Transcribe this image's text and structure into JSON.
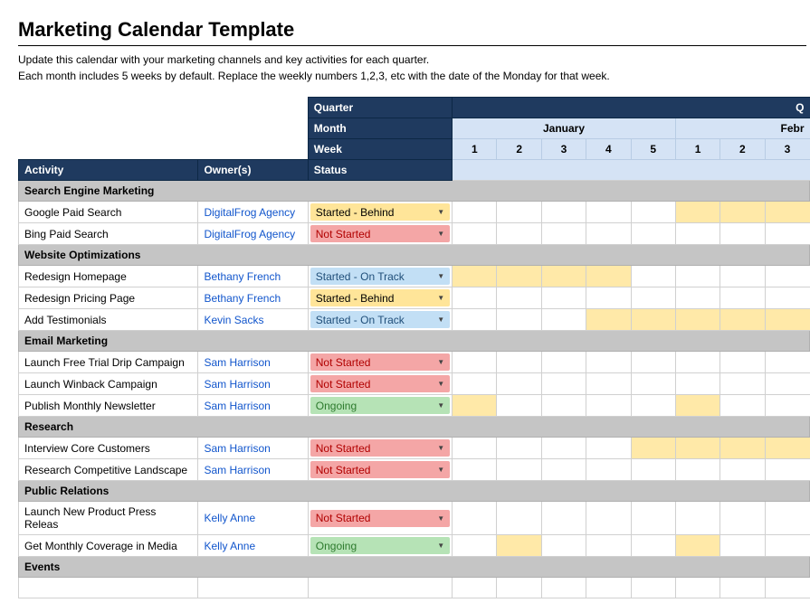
{
  "page": {
    "title": "Marketing Calendar Template",
    "subtitle_line1": "Update this calendar with your marketing channels and key activities for each quarter.",
    "subtitle_line2": "Each month includes 5 weeks by default. Replace the weekly numbers 1,2,3, etc with the date of the Monday for that week."
  },
  "headers": {
    "quarter": "Quarter",
    "q1_partial": "Q",
    "month": "Month",
    "week": "Week",
    "january": "January",
    "february_partial": "Febr",
    "activity": "Activity",
    "owner": "Owner(s)",
    "status": "Status",
    "w1": "1",
    "w2": "2",
    "w3": "3",
    "w4": "4",
    "w5": "5",
    "f1": "1",
    "f2": "2",
    "f3": "3"
  },
  "sections": [
    {
      "name": "Search Engine Marketing",
      "rows": [
        {
          "activity": "Google Paid Search",
          "owner": "DigitalFrog Agency",
          "status": "Started - Behind",
          "status_class": "status-behind",
          "highlights": [
            5,
            6,
            7
          ]
        },
        {
          "activity": "Bing Paid Search",
          "owner": "DigitalFrog Agency",
          "status": "Not Started",
          "status_class": "status-not-started",
          "highlights": []
        }
      ]
    },
    {
      "name": "Website Optimizations",
      "rows": [
        {
          "activity": "Redesign Homepage",
          "owner": "Bethany French",
          "status": "Started - On Track",
          "status_class": "status-on-track",
          "highlights": [
            0,
            1,
            2,
            3
          ]
        },
        {
          "activity": "Redesign Pricing Page",
          "owner": "Bethany French",
          "status": "Started - Behind",
          "status_class": "status-behind",
          "highlights": []
        },
        {
          "activity": "Add Testimonials",
          "owner": "Kevin Sacks",
          "status": "Started - On Track",
          "status_class": "status-on-track",
          "highlights": [
            3,
            4,
            5,
            6,
            7
          ]
        }
      ]
    },
    {
      "name": "Email Marketing",
      "rows": [
        {
          "activity": "Launch Free Trial Drip Campaign",
          "owner": "Sam Harrison",
          "status": "Not Started",
          "status_class": "status-not-started",
          "highlights": []
        },
        {
          "activity": "Launch Winback Campaign",
          "owner": "Sam Harrison",
          "status": "Not Started",
          "status_class": "status-not-started",
          "highlights": []
        },
        {
          "activity": "Publish Monthly Newsletter",
          "owner": "Sam Harrison",
          "status": "Ongoing",
          "status_class": "status-ongoing",
          "highlights": [
            0,
            5
          ]
        }
      ]
    },
    {
      "name": "Research",
      "rows": [
        {
          "activity": "Interview Core Customers",
          "owner": "Sam Harrison",
          "status": "Not Started",
          "status_class": "status-not-started",
          "highlights": [
            4,
            5,
            6,
            7
          ]
        },
        {
          "activity": "Research Competitive Landscape",
          "owner": "Sam Harrison",
          "status": "Not Started",
          "status_class": "status-not-started",
          "highlights": []
        }
      ]
    },
    {
      "name": "Public Relations",
      "rows": [
        {
          "activity": "Launch New Product Press Releas",
          "owner": "Kelly Anne",
          "status": "Not Started",
          "status_class": "status-not-started",
          "highlights": []
        },
        {
          "activity": "Get Monthly Coverage in Media",
          "owner": "Kelly Anne",
          "status": "Ongoing",
          "status_class": "status-ongoing",
          "highlights": [
            1,
            5
          ]
        }
      ]
    },
    {
      "name": "Events",
      "rows": [
        {
          "activity": "",
          "owner": "",
          "status": "",
          "status_class": "",
          "highlights": []
        }
      ]
    }
  ]
}
